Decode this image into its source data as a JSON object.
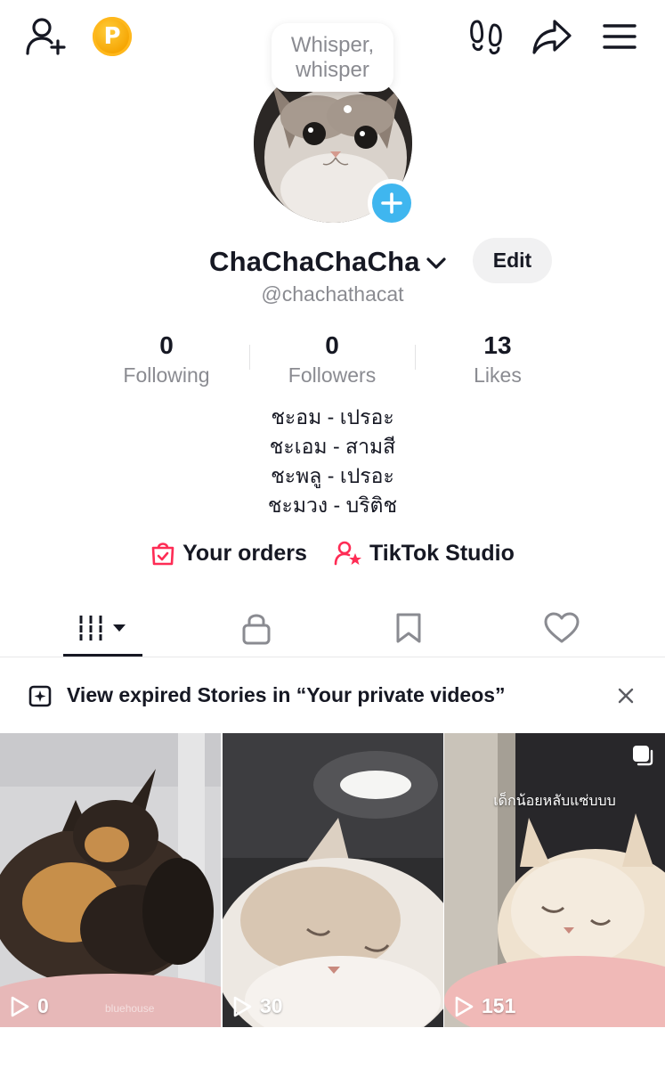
{
  "top_bar": {
    "add_friend_icon": "person-plus-icon",
    "coin_label": "P",
    "footprints_icon": "footprints-icon",
    "share_icon": "share-arrow-icon",
    "menu_icon": "hamburger-menu-icon"
  },
  "avatar": {
    "whisper_text": "Whisper, whisper",
    "add_icon": "plus-icon"
  },
  "profile": {
    "display_name": "ChaChaChaCha",
    "handle": "@chachathacat",
    "edit_label": "Edit"
  },
  "stats": [
    {
      "value": "0",
      "label": "Following"
    },
    {
      "value": "0",
      "label": "Followers"
    },
    {
      "value": "13",
      "label": "Likes"
    }
  ],
  "bio": [
    "ชะอม - เปรอะ",
    "ชะเอม - สามสี",
    "ชะพลู - เปรอะ",
    "ชะมวง - บริติช"
  ],
  "links": [
    {
      "label": "Your orders",
      "icon": "shopping-bag-check-icon"
    },
    {
      "label": "TikTok Studio",
      "icon": "person-star-icon"
    }
  ],
  "tabs": [
    {
      "name": "videos",
      "icon": "grid-bars-icon",
      "active": true
    },
    {
      "name": "private",
      "icon": "lock-icon"
    },
    {
      "name": "saved",
      "icon": "bookmark-icon"
    },
    {
      "name": "liked",
      "icon": "heart-icon"
    }
  ],
  "banner": {
    "text": "View expired Stories in “Your private videos”",
    "icon": "story-sparkle-icon",
    "close_icon": "close-icon"
  },
  "videos": [
    {
      "views": "0",
      "watermark": "bluehouse"
    },
    {
      "views": "30"
    },
    {
      "views": "151",
      "caption": "เด็กน้อยหลับแซ่บบบ",
      "multi_icon": "multi-photo-icon"
    }
  ],
  "colors": {
    "accent_red": "#fe2c55",
    "avatar_add_blue": "#3fb6ef",
    "coin_gold": "#f5a300",
    "secondary_text": "#8a8b91"
  }
}
